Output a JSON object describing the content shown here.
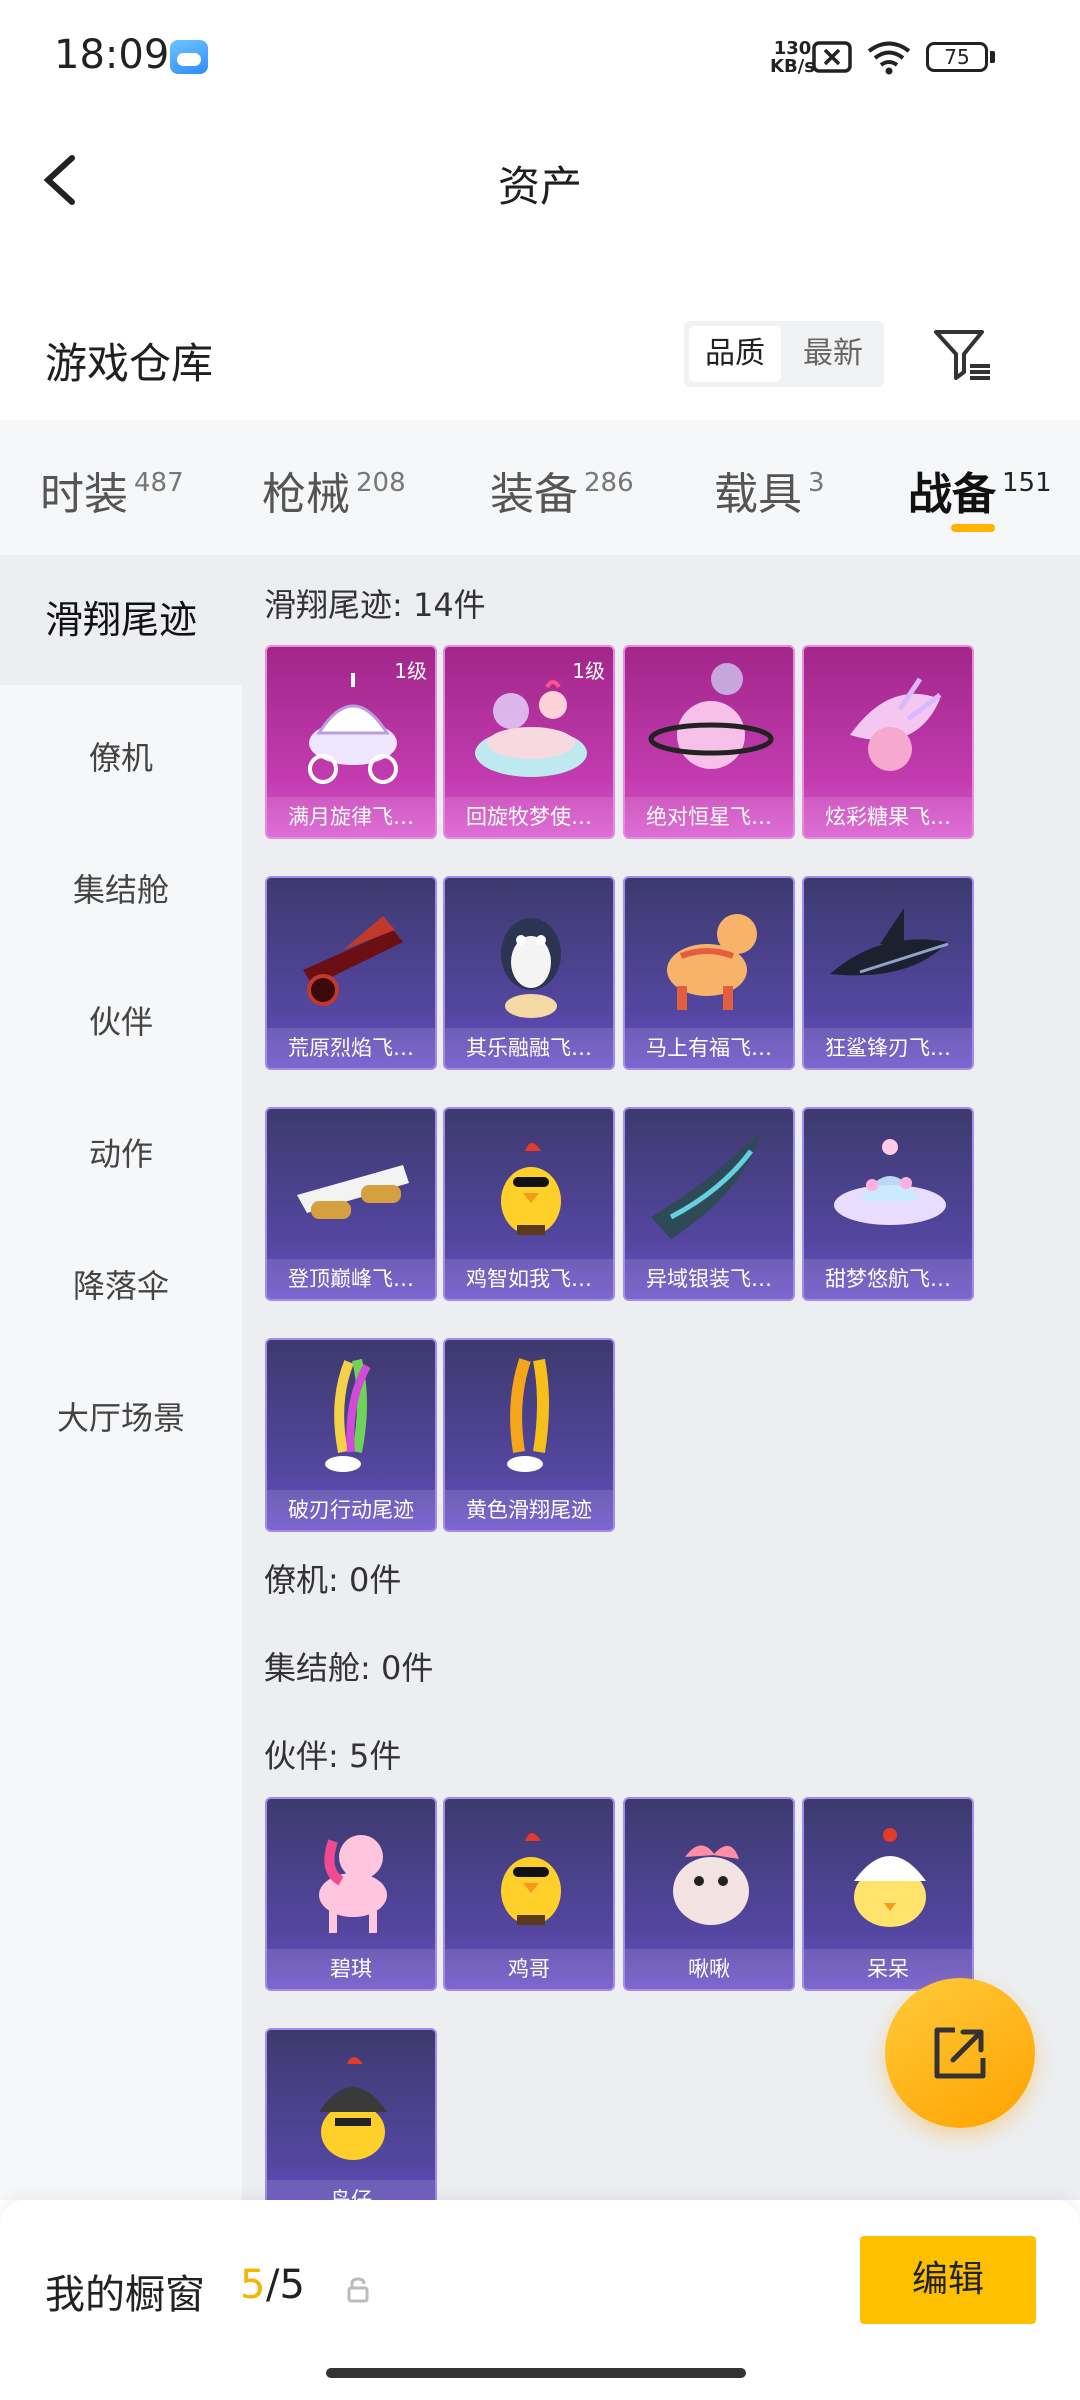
{
  "status_bar": {
    "time": "18:09",
    "net_speed_value": "130",
    "net_speed_unit": "KB/s",
    "battery": "75"
  },
  "header": {
    "title": "资产"
  },
  "warehouse": {
    "title": "游戏仓库",
    "sort_options": [
      "品质",
      "最新"
    ],
    "sort_selected": "品质"
  },
  "tabs": [
    {
      "label": "时装",
      "count": "487"
    },
    {
      "label": "枪械",
      "count": "208"
    },
    {
      "label": "装备",
      "count": "286"
    },
    {
      "label": "载具",
      "count": "3"
    },
    {
      "label": "战备",
      "count": "151"
    }
  ],
  "active_tab": "战备",
  "sidebar": {
    "items": [
      "滑翔尾迹",
      "僚机",
      "集结舱",
      "伙伴",
      "动作",
      "降落伞",
      "大厅场景"
    ],
    "active": "滑翔尾迹"
  },
  "sections": [
    {
      "title": "滑翔尾迹: 14件",
      "items": [
        {
          "name": "满月旋律飞…",
          "level": "1级",
          "rarity": "pink",
          "icon": "carriage"
        },
        {
          "name": "回旋牧梦使…",
          "level": "1级",
          "rarity": "pink",
          "icon": "cake-cart"
        },
        {
          "name": "绝对恒星飞…",
          "level": "",
          "rarity": "pink",
          "icon": "planet"
        },
        {
          "name": "炫彩糖果飞…",
          "level": "",
          "rarity": "pink",
          "icon": "candy-flower"
        },
        {
          "name": "荒原烈焰飞…",
          "level": "",
          "rarity": "purple",
          "icon": "flame-bike"
        },
        {
          "name": "其乐融融飞…",
          "level": "",
          "rarity": "purple",
          "icon": "penguin"
        },
        {
          "name": "马上有福飞…",
          "level": "",
          "rarity": "purple",
          "icon": "horse"
        },
        {
          "name": "狂鲨锋刃飞…",
          "level": "",
          "rarity": "purple",
          "icon": "shark"
        },
        {
          "name": "登顶巅峰飞…",
          "level": "",
          "rarity": "purple",
          "icon": "jet"
        },
        {
          "name": "鸡智如我飞…",
          "level": "",
          "rarity": "purple",
          "icon": "chicken"
        },
        {
          "name": "异域银装飞…",
          "level": "",
          "rarity": "purple",
          "icon": "wing"
        },
        {
          "name": "甜梦悠航飞…",
          "level": "",
          "rarity": "purple",
          "icon": "ufo"
        },
        {
          "name": "破刃行动尾迹",
          "level": "",
          "rarity": "purple",
          "icon": "trail-rainbow"
        },
        {
          "name": "黄色滑翔尾迹",
          "level": "",
          "rarity": "purple",
          "icon": "trail-yellow"
        }
      ]
    },
    {
      "title": "僚机: 0件",
      "items": []
    },
    {
      "title": "集结舱: 0件",
      "items": []
    },
    {
      "title": "伙伴: 5件",
      "items": [
        {
          "name": "碧琪",
          "level": "",
          "rarity": "purple",
          "icon": "pony"
        },
        {
          "name": "鸡哥",
          "level": "",
          "rarity": "purple",
          "icon": "chicken"
        },
        {
          "name": "啾啾",
          "level": "",
          "rarity": "purple",
          "icon": "bird"
        },
        {
          "name": "呆呆",
          "level": "",
          "rarity": "purple",
          "icon": "chick"
        },
        {
          "name": "岛仔",
          "level": "",
          "rarity": "purple",
          "icon": "helmet-chick"
        }
      ]
    }
  ],
  "showcase": {
    "label": "我的橱窗",
    "current": "5",
    "total": "/5",
    "edit_label": "编辑"
  },
  "colors": {
    "accent": "#ffc000",
    "pink_card": "#c23cb0",
    "purple_card": "#5446a1"
  }
}
